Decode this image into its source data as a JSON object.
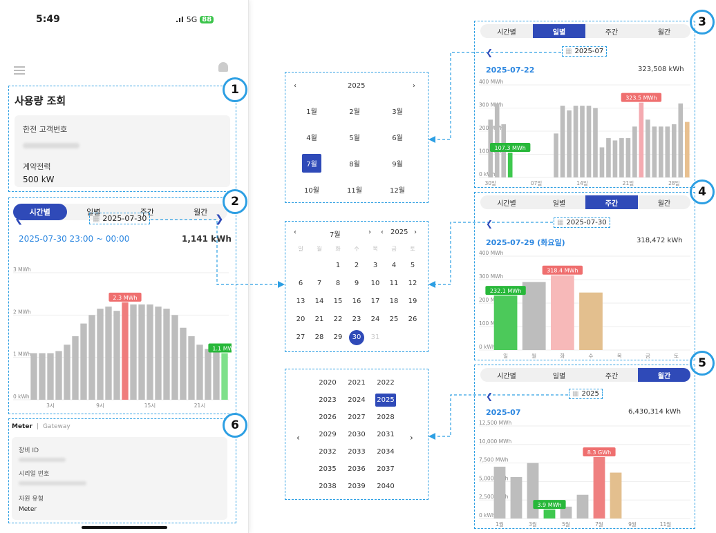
{
  "phone": {
    "time": "5:49",
    "signal": "5G",
    "battery": "88",
    "section1": {
      "title": "사용량 조회",
      "customer_label": "한전 고객번호",
      "contract_label": "계약전력",
      "contract_value": "500 kW"
    },
    "section2": {
      "tabs": [
        "시간별",
        "일별",
        "주간",
        "월간"
      ],
      "date": "2025-07-30",
      "range": "2025-07-30 23:00 ~ 00:00",
      "total": "1,141 kWh"
    },
    "section6": {
      "tabs": [
        "Meter",
        "Gateway"
      ],
      "fields": [
        {
          "label": "장비 ID"
        },
        {
          "label": "시리얼 번호"
        },
        {
          "label": "자원 유형",
          "value": "Meter"
        }
      ]
    }
  },
  "labels": [
    "1",
    "2",
    "3",
    "4",
    "5",
    "6"
  ],
  "month_picker": {
    "year": "2025",
    "months": [
      "1월",
      "2월",
      "3월",
      "4월",
      "5월",
      "6월",
      "7월",
      "8월",
      "9월",
      "10월",
      "11월",
      "12월"
    ],
    "selected": "7월"
  },
  "day_picker": {
    "month": "7월",
    "year": "2025",
    "weekdays": [
      "일",
      "월",
      "화",
      "수",
      "목",
      "금",
      "토"
    ],
    "selected": "30",
    "after": "31"
  },
  "year_picker": {
    "years": [
      "2020",
      "2021",
      "2022",
      "2023",
      "2024",
      "2025",
      "2026",
      "2027",
      "2028",
      "2029",
      "2030",
      "2031",
      "2032",
      "2033",
      "2034",
      "2035",
      "2036",
      "2037",
      "2038",
      "2039",
      "2040"
    ],
    "selected": "2025"
  },
  "panel3": {
    "tabs": [
      "시간별",
      "일별",
      "주간",
      "월간"
    ],
    "date": "2025-07",
    "date_row": "2025-07-22",
    "total": "323,508 kWh"
  },
  "panel4": {
    "tabs": [
      "시간별",
      "일별",
      "주간",
      "월간"
    ],
    "date": "2025-07-30",
    "date_row": "2025-07-29 (화요일)",
    "total": "318,472 kWh"
  },
  "panel5": {
    "tabs": [
      "시간별",
      "일별",
      "주간",
      "월간"
    ],
    "date": "2025",
    "date_row": "2025-07",
    "total": "6,430,314 kWh"
  },
  "chart_data": [
    {
      "type": "bar",
      "title": "hourly",
      "ylim": [
        0,
        3
      ],
      "ytick_labels": [
        "3 MWh",
        "2 MWh",
        "1 MWh",
        "0 kWh"
      ],
      "xtick_labels": [
        "3시",
        "9시",
        "15시",
        "21시"
      ],
      "values": [
        1.1,
        1.1,
        1.1,
        1.15,
        1.3,
        1.5,
        1.8,
        2.0,
        2.15,
        2.2,
        2.1,
        2.3,
        2.25,
        2.25,
        2.25,
        2.2,
        2.15,
        2.0,
        1.7,
        1.5,
        1.3,
        1.2,
        1.15,
        1.1
      ],
      "highlight": {
        "index": 11,
        "label": "2.3 MWh",
        "color": "#ef7c7c"
      },
      "last": {
        "index": 23,
        "label": "1.1 MWh",
        "color": "#7ee08a"
      }
    },
    {
      "type": "bar",
      "title": "daily",
      "ylim": [
        0,
        400
      ],
      "ytick_labels": [
        "400 MWh",
        "300 MWh",
        "200 MWh",
        "100 MWh",
        "0 kWh"
      ],
      "xtick_labels": [
        "30일",
        "07일",
        "14일",
        "21일",
        "28일"
      ],
      "values": [
        250,
        320,
        230,
        107.3,
        0,
        0,
        0,
        0,
        0,
        0,
        190,
        310,
        290,
        310,
        310,
        310,
        300,
        130,
        170,
        160,
        170,
        170,
        220,
        323.5,
        250,
        220,
        220,
        220,
        230,
        320,
        240
      ],
      "highlight": {
        "index": 23,
        "label": "323.5 MWh",
        "color": "#f4aab0"
      },
      "min": {
        "index": 3,
        "label": "107.3 MWh",
        "color": "#3ec84e"
      },
      "last_color": "#e8c090"
    },
    {
      "type": "bar",
      "title": "weekly",
      "ylim": [
        0,
        400
      ],
      "ytick_labels": [
        "400 MWh",
        "300 MWh",
        "200 MWh",
        "100 MWh",
        "0 kWh"
      ],
      "xtick_labels": [
        "일",
        "월",
        "화",
        "수",
        "목",
        "금",
        "토"
      ],
      "values": [
        232.1,
        290,
        318.4,
        245,
        0,
        0,
        0
      ],
      "colors": [
        "#4cc95a",
        "#bdbdbd",
        "#f7b9b9",
        "#e3bf8e",
        "",
        "",
        ""
      ],
      "labels": [
        {
          "index": 0,
          "text": "232.1 MWh",
          "color": "#28b83a"
        },
        {
          "index": 2,
          "text": "318.4 MWh",
          "color": "#ef6f6f"
        }
      ]
    },
    {
      "type": "bar",
      "title": "monthly",
      "ylim": [
        0,
        12500
      ],
      "ytick_labels": [
        "12,500 MWh",
        "10,000 MWh",
        "7,500 MWh",
        "5,000 MWh",
        "2,500 MWh",
        "0 kWh"
      ],
      "xtick_labels": [
        "1월",
        "3월",
        "5월",
        "7월",
        "9월",
        "11월"
      ],
      "values": [
        7000,
        5600,
        7500,
        1200,
        1600,
        3200,
        8300,
        6200,
        0,
        0,
        0,
        0
      ],
      "colors": [
        "#bdbdbd",
        "#bdbdbd",
        "#bdbdbd",
        "#3ec84e",
        "#bdbdbd",
        "#bdbdbd",
        "#ef8080",
        "#e3bf8e",
        "",
        "",
        "",
        ""
      ],
      "labels": [
        {
          "index": 6,
          "text": "8.3 GWh",
          "color": "#ef6f6f"
        },
        {
          "index": 3,
          "text": "3.9 MWh",
          "color": "#28b83a"
        }
      ]
    }
  ]
}
